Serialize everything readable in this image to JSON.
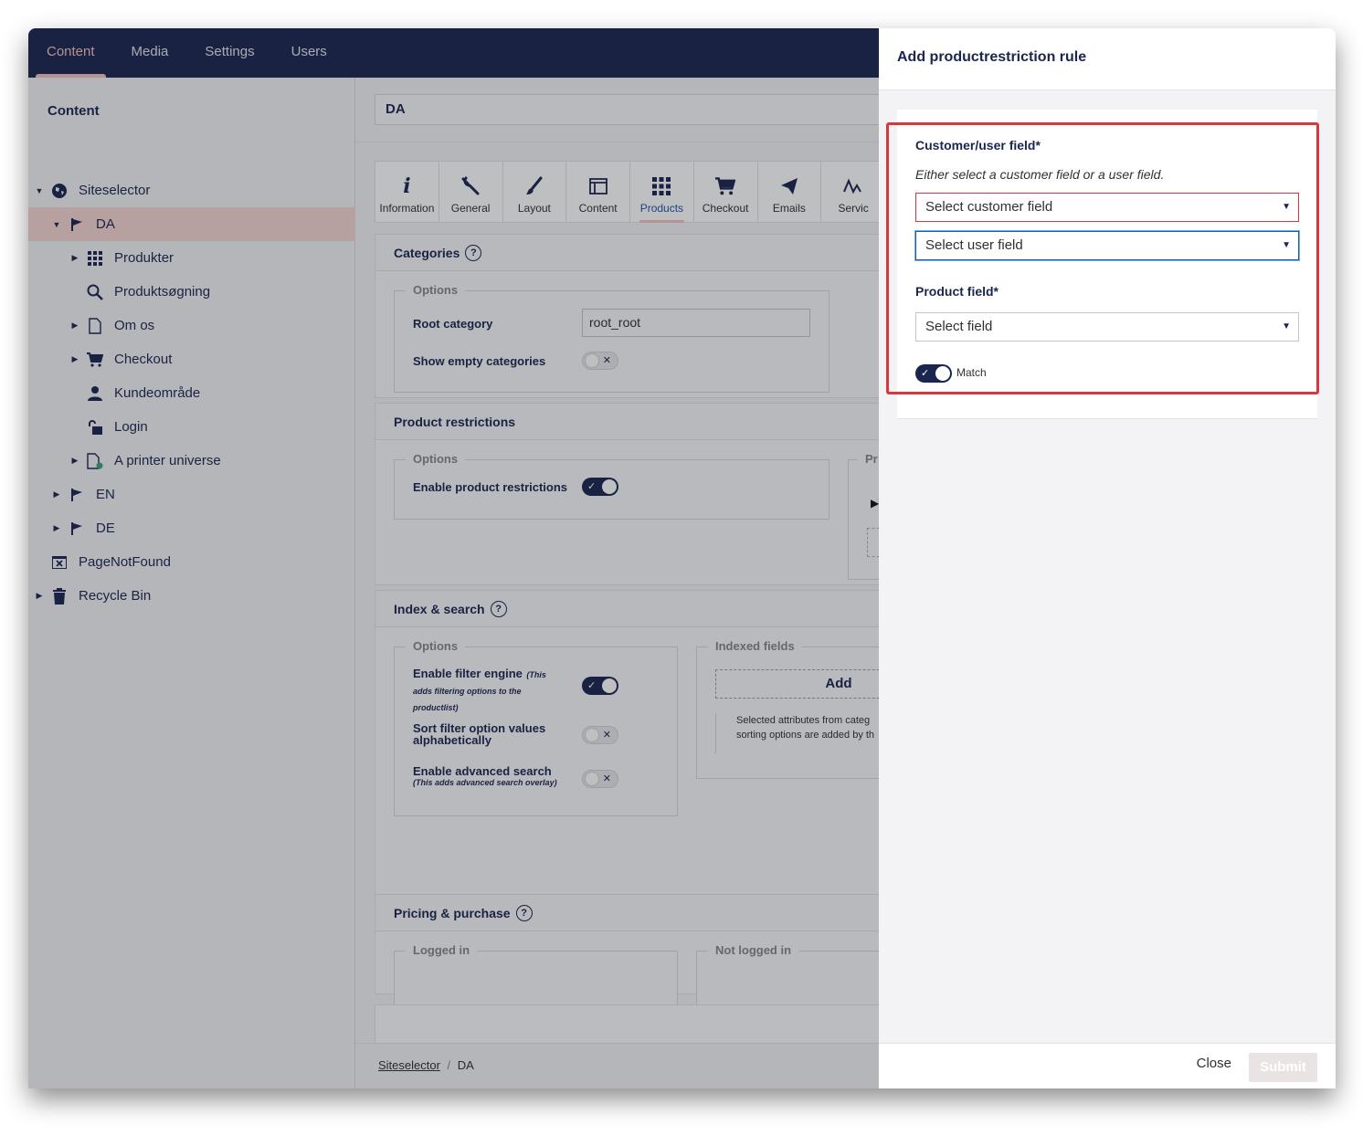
{
  "topnav": {
    "tabs": [
      "Content",
      "Media",
      "Settings",
      "Users"
    ]
  },
  "sidebar": {
    "title": "Content",
    "items": [
      "Siteselector",
      "DA",
      "Produkter",
      "Produktsøgning",
      "Om os",
      "Checkout",
      "Kundeområde",
      "Login",
      "A printer universe",
      "EN",
      "DE",
      "PageNotFound",
      "Recycle Bin"
    ]
  },
  "main": {
    "node_name": "DA",
    "apps": [
      "Information",
      "General",
      "Layout",
      "Content",
      "Products",
      "Checkout",
      "Emails",
      "Servic"
    ],
    "categories": {
      "title": "Categories",
      "options_legend": "Options",
      "root_category_label": "Root category",
      "root_category_value": "root_root",
      "show_empty_label": "Show empty categories"
    },
    "product_restrictions": {
      "title": "Product restrictions",
      "options_legend": "Options",
      "enable_label": "Enable product restrictions",
      "side_legend": "Pr"
    },
    "index_search": {
      "title": "Index & search",
      "options_legend": "Options",
      "filter_label": "Enable filter engine",
      "filter_sub": "(This adds filtering options to the productlist)",
      "sort_label": "Sort filter option values alphabetically",
      "advanced_label": "Enable advanced search",
      "advanced_sub": "(This adds advanced search overlay)",
      "indexed_legend": "Indexed fields",
      "add_label": "Add",
      "indexed_help_1": "Selected attributes from categ",
      "indexed_help_2": "sorting options are added by th"
    },
    "pricing": {
      "title": "Pricing & purchase",
      "logged_in_legend": "Logged in",
      "not_logged_in_legend": "Not logged in"
    },
    "breadcrumb": {
      "root": "Siteselector",
      "separator": "/",
      "current": "DA"
    }
  },
  "dialog": {
    "title": "Add productrestriction rule",
    "customer_user_label": "Customer/user field*",
    "customer_user_help": "Either select a customer field or a user field.",
    "customer_placeholder": "Select customer field",
    "user_placeholder": "Select user field",
    "product_label": "Product field*",
    "product_placeholder": "Select field",
    "match_label": "Match",
    "close_label": "Close",
    "submit_label": "Submit"
  },
  "colors": {
    "nav": "#1b264f",
    "accent": "#f5c1bc",
    "error": "#d9363e",
    "focus": "#2152a3"
  }
}
